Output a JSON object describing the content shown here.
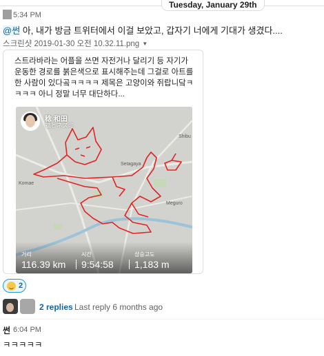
{
  "date_divider": "Tuesday, January 29th",
  "message1": {
    "time": "5:34 PM",
    "mention": "@썬",
    "text": " 아, 내가 방금 트위터에서 이걸 보았고, 갑자기 너에게 기대가 생겼다....",
    "file_name": "스크린샷 2019-01-30 오전 10.32.11.png"
  },
  "card": {
    "description": "스트라바라는 어플을 쓰면 자전거나 달리기 등 자기가 운동한 경로를 붉은색으로 표시해주는데 그걸로 아트를 한 사람이 있다곸ㅋㅋㅋㅋ 제목은 고양이와 쥐랍니닼ㅋㅋㅋㅋ 아니 정말 너무 대단하다...",
    "map": {
      "user_name": "稔 和田",
      "subtitle": "猫とネズミ",
      "places": [
        "Shibu",
        "Setagaya",
        "Komae",
        "Meguro"
      ],
      "stats": [
        {
          "label": "거리",
          "value": "116.39 km"
        },
        {
          "label": "시간",
          "value": "9:54:58"
        },
        {
          "label": "상승고도",
          "value": "1,183 m"
        }
      ]
    }
  },
  "reaction": {
    "emoji": "grinning-face",
    "count": "2"
  },
  "thread": {
    "reply_count": "2 replies",
    "last_reply": "Last reply 6 months ago"
  },
  "message2": {
    "author": "썬",
    "time": "6:04 PM",
    "text": "ㅋㅋㅋㅋㅋ"
  },
  "colors": {
    "route": "#e02424",
    "link": "#1264a3",
    "mention_bg": "#e8f5fa"
  }
}
